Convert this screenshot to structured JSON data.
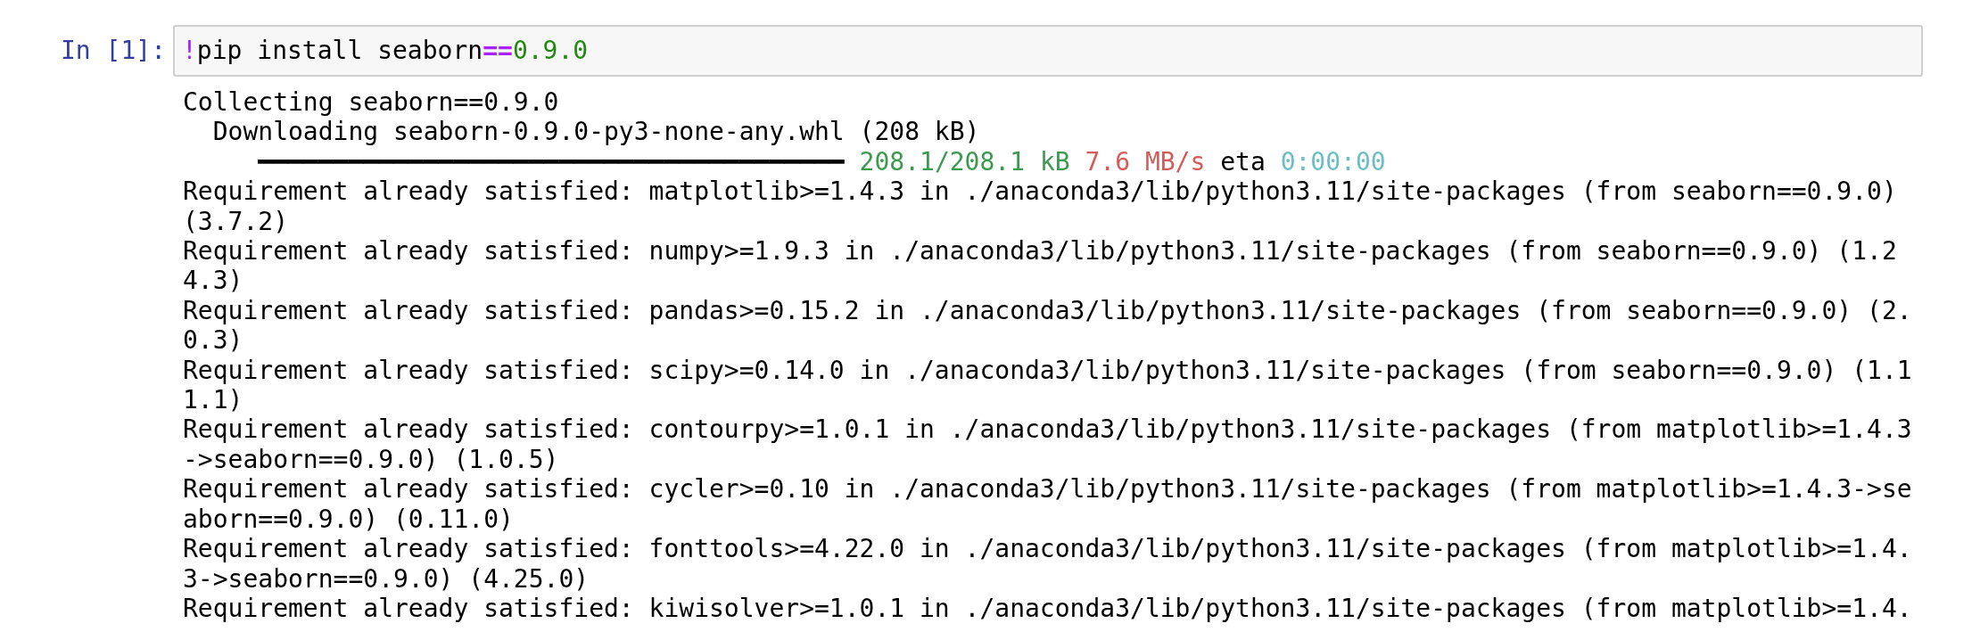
{
  "cell": {
    "prompt": "In [1]:",
    "input": [
      {
        "kind": "magic",
        "text": "!"
      },
      {
        "kind": "plain",
        "text": "pip install seaborn"
      },
      {
        "kind": "operator",
        "text": "=="
      },
      {
        "kind": "number",
        "text": "0.9.0"
      }
    ],
    "output": [
      [
        {
          "kind": "plain",
          "text": "Collecting seaborn==0.9.0"
        }
      ],
      [
        {
          "kind": "plain",
          "text": "  Downloading seaborn-0.9.0-py3-none-any.whl (208 kB)"
        }
      ],
      [
        {
          "kind": "plain",
          "text": "     ━━━━━━━━━━━━━━━━━━━━━━━━━━━━━━━━━━━━━━━ "
        },
        {
          "kind": "size",
          "text": "208.1/208.1 kB"
        },
        {
          "kind": "speed",
          "text": " 7.6 MB/s"
        },
        {
          "kind": "plain",
          "text": " eta "
        },
        {
          "kind": "time",
          "text": "0:00:00"
        }
      ],
      [
        {
          "kind": "plain",
          "text": "Requirement already satisfied: matplotlib>=1.4.3 in ./anaconda3/lib/python3.11/site-packages (from seaborn==0.9.0)"
        }
      ],
      [
        {
          "kind": "plain",
          "text": "(3.7.2)"
        }
      ],
      [
        {
          "kind": "plain",
          "text": "Requirement already satisfied: numpy>=1.9.3 in ./anaconda3/lib/python3.11/site-packages (from seaborn==0.9.0) (1.2"
        }
      ],
      [
        {
          "kind": "plain",
          "text": "4.3)"
        }
      ],
      [
        {
          "kind": "plain",
          "text": "Requirement already satisfied: pandas>=0.15.2 in ./anaconda3/lib/python3.11/site-packages (from seaborn==0.9.0) (2."
        }
      ],
      [
        {
          "kind": "plain",
          "text": "0.3)"
        }
      ],
      [
        {
          "kind": "plain",
          "text": "Requirement already satisfied: scipy>=0.14.0 in ./anaconda3/lib/python3.11/site-packages (from seaborn==0.9.0) (1.1"
        }
      ],
      [
        {
          "kind": "plain",
          "text": "1.1)"
        }
      ],
      [
        {
          "kind": "plain",
          "text": "Requirement already satisfied: contourpy>=1.0.1 in ./anaconda3/lib/python3.11/site-packages (from matplotlib>=1.4.3"
        }
      ],
      [
        {
          "kind": "plain",
          "text": "->seaborn==0.9.0) (1.0.5)"
        }
      ],
      [
        {
          "kind": "plain",
          "text": "Requirement already satisfied: cycler>=0.10 in ./anaconda3/lib/python3.11/site-packages (from matplotlib>=1.4.3->se"
        }
      ],
      [
        {
          "kind": "plain",
          "text": "aborn==0.9.0) (0.11.0)"
        }
      ],
      [
        {
          "kind": "plain",
          "text": "Requirement already satisfied: fonttools>=4.22.0 in ./anaconda3/lib/python3.11/site-packages (from matplotlib>=1.4."
        }
      ],
      [
        {
          "kind": "plain",
          "text": "3->seaborn==0.9.0) (4.25.0)"
        }
      ],
      [
        {
          "kind": "plain",
          "text": "Requirement already satisfied: kiwisolver>=1.0.1 in ./anaconda3/lib/python3.11/site-packages (from matplotlib>=1.4."
        }
      ]
    ]
  }
}
